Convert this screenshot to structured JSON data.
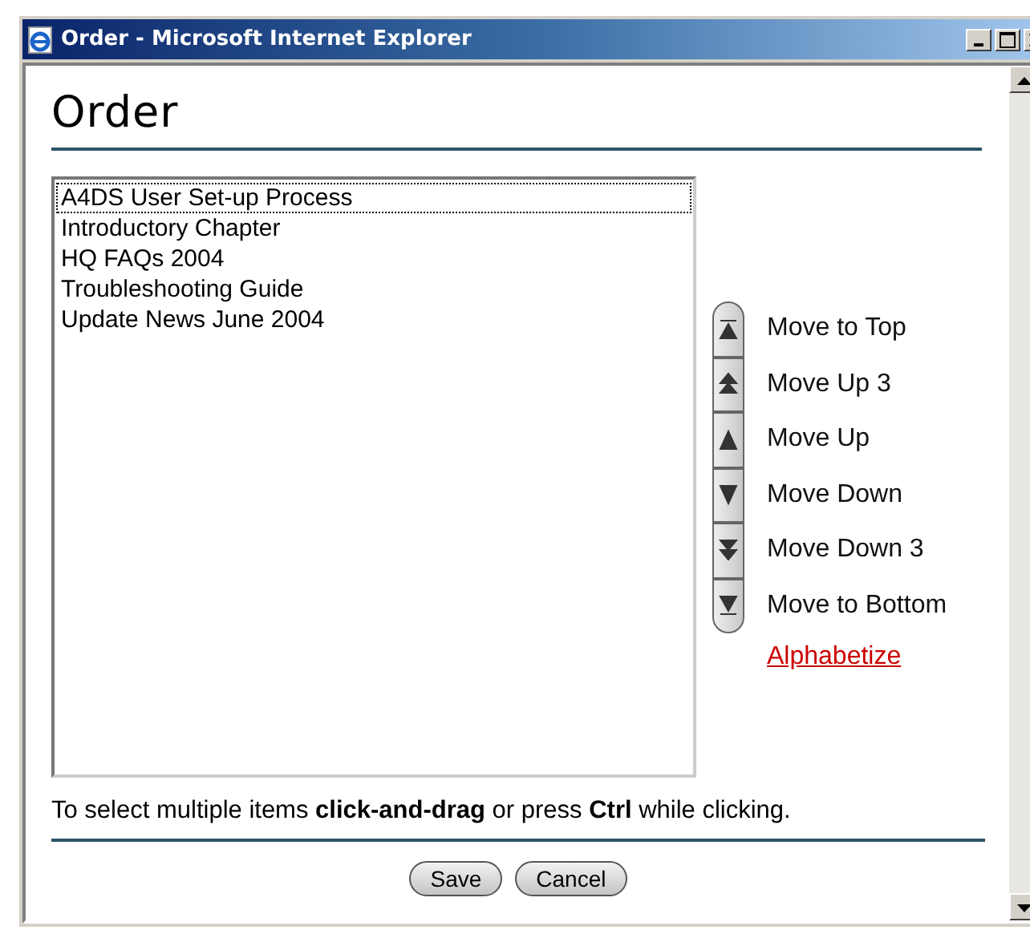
{
  "window": {
    "title": "Order - Microsoft Internet Explorer"
  },
  "heading": "Order",
  "list_items": [
    {
      "label": "A4DS User Set-up Process",
      "focused": true
    },
    {
      "label": "Introductory Chapter",
      "focused": false
    },
    {
      "label": "HQ FAQs 2004",
      "focused": false
    },
    {
      "label": "Troubleshooting Guide",
      "focused": false
    },
    {
      "label": "Update News June 2004",
      "focused": false
    }
  ],
  "move_buttons": [
    {
      "kind": "top",
      "label": "Move to Top"
    },
    {
      "kind": "up3",
      "label": "Move Up 3"
    },
    {
      "kind": "up",
      "label": "Move Up"
    },
    {
      "kind": "down",
      "label": "Move Down"
    },
    {
      "kind": "down3",
      "label": "Move Down 3"
    },
    {
      "kind": "bottom",
      "label": "Move to Bottom"
    }
  ],
  "alphabetize_link": "Alphabetize",
  "hint": "To select multiple items **click-and-drag** or press **Ctrl** while clicking.",
  "buttons": [
    "Save",
    "Cancel"
  ]
}
